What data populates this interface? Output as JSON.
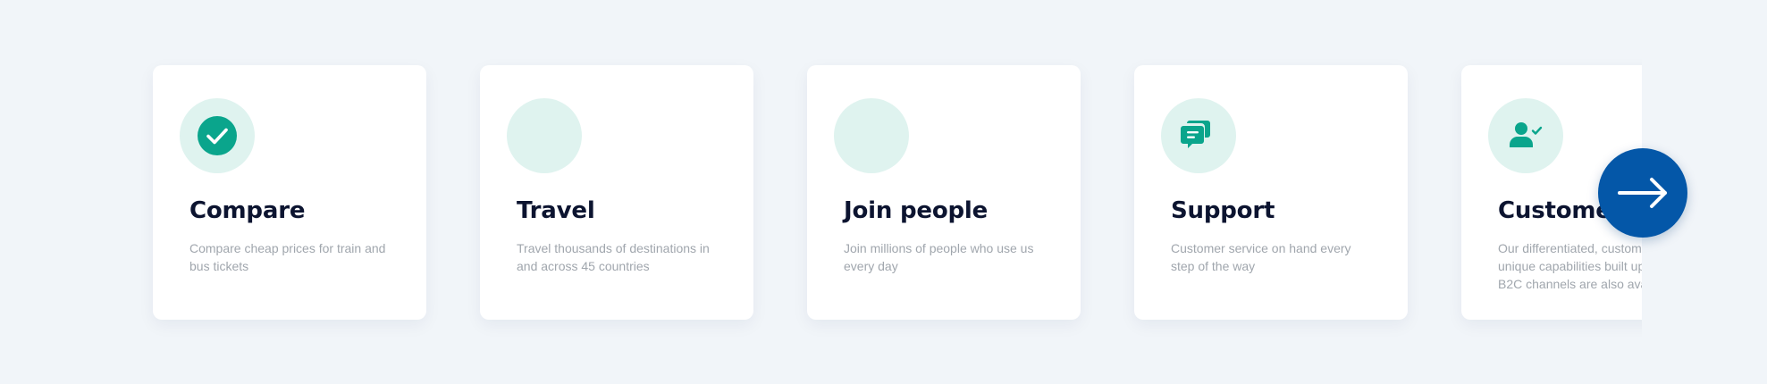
{
  "carousel": {
    "cards": [
      {
        "title": "Compare",
        "description": "Compare cheap prices for train and bus tickets",
        "icon": "check-circle-icon"
      },
      {
        "title": "Travel",
        "description": "Travel thousands of destinations in and across 45 countries",
        "icon": "empty-icon-placeholder"
      },
      {
        "title": "Join people",
        "description": "Join millions of people who use us every day",
        "icon": "empty-icon-placeholder"
      },
      {
        "title": "Support",
        "description": "Customer service on hand every step of the way",
        "icon": "chat-bubbles-icon"
      },
      {
        "title": "Customer",
        "description": "Our differentiated, customer features and unique capabilities built up across our highly B2C channels are also available",
        "icon": "user-check-icon"
      }
    ],
    "next_button_icon": "arrow-right-icon"
  },
  "colors": {
    "page_background": "#f1f5f9",
    "card_background": "#ffffff",
    "icon_circle": "#dff3ef",
    "accent_teal": "#0aa58c",
    "title_text": "#0c1430",
    "description_text": "#a0a6ad",
    "next_button": "#0457a8"
  }
}
